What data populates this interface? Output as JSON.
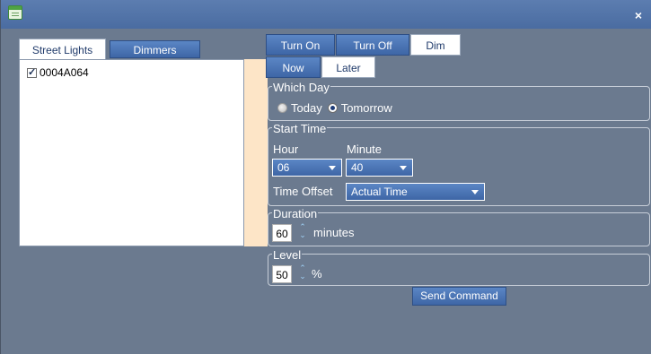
{
  "window": {
    "close_glyph": "×",
    "icon": "app-icon"
  },
  "left_tabs": {
    "active": "Street Lights",
    "inactive": "Dimmers"
  },
  "devices": [
    {
      "id": "0004A064",
      "checked": true
    }
  ],
  "action_tabs": {
    "turn_on": "Turn On",
    "turn_off": "Turn Off",
    "dim": "Dim"
  },
  "timing_tabs": {
    "now": "Now",
    "later": "Later"
  },
  "which_day": {
    "title": "Which Day",
    "options": [
      "Today",
      "Tomorrow"
    ],
    "selected": "Tomorrow"
  },
  "start_time": {
    "title": "Start Time",
    "hour_label": "Hour",
    "minute_label": "Minute",
    "hour_value": "06",
    "minute_value": "40",
    "offset_label": "Time Offset",
    "offset_value": "Actual Time"
  },
  "duration": {
    "title": "Duration",
    "value": "60",
    "unit": "minutes"
  },
  "level": {
    "title": "Level",
    "value": "50",
    "unit": "%"
  },
  "send_button": "Send Command",
  "colors": {
    "background": "#6b7a8f",
    "titlebar": "#4f72a8",
    "accent_blue": "#3e66a6",
    "peach": "#fde5c7"
  }
}
